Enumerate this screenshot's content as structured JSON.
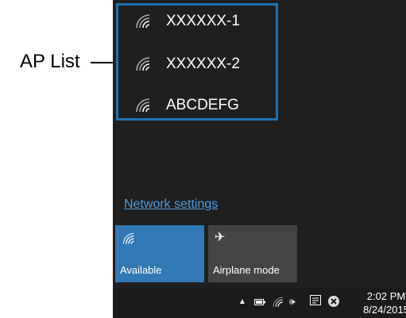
{
  "callout": {
    "label": "AP List"
  },
  "networks": [
    {
      "name": "XXXXXX-1",
      "icon": "wifi-icon"
    },
    {
      "name": "XXXXXX-2",
      "icon": "wifi-icon"
    },
    {
      "name": "ABCDEFG",
      "icon": "wifi-icon"
    }
  ],
  "network_settings_link": "Network settings",
  "quick_actions": {
    "available": {
      "label": "Available",
      "icon": "wifi-icon",
      "color": "#3278b4"
    },
    "airplane": {
      "label": "Airplane mode",
      "icon": "airplane-icon",
      "color": "#444444"
    }
  },
  "taskbar": {
    "time": "2:02 PM",
    "date": "8/24/2015",
    "icons": [
      "chevron-up-icon",
      "battery-icon",
      "wifi-icon",
      "volume-icon",
      "action-center-icon",
      "close-circle-icon"
    ]
  },
  "colors": {
    "accent": "#1a73b5",
    "panel_bg": "#1f1f1f",
    "link": "#4a9be0"
  }
}
